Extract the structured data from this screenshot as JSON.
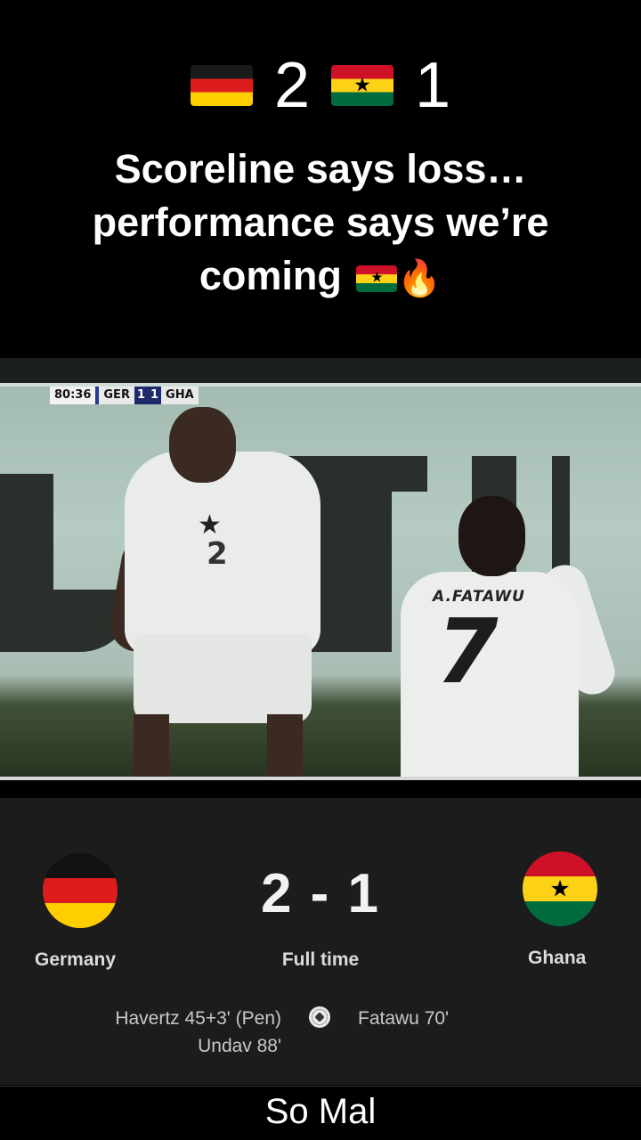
{
  "caption": {
    "home_score": "2",
    "away_score": "1",
    "line1": "Scoreline says loss…",
    "line2": "performance says we’re",
    "line3": "coming",
    "home_flag_icon": "germany-flag-icon",
    "away_flag_icon": "ghana-flag-icon",
    "trailing_icon": "fire-icon"
  },
  "video": {
    "clock": "80:36",
    "home_abbr": "GER",
    "home_goals": "1",
    "away_goals": "1",
    "away_abbr": "GHA",
    "jersey_name": "A.FATAWU",
    "jersey_number": "7",
    "other_jersey_number": "2"
  },
  "result": {
    "home_team": "Germany",
    "away_team": "Ghana",
    "score": "2 - 1",
    "status": "Full time",
    "home_scorers": [
      "Havertz 45+3' (Pen)",
      "Undav 88'"
    ],
    "away_scorers": [
      "Fatawu 70'"
    ],
    "goal_icon": "soccer-ball-icon"
  },
  "footer": {
    "text": "So Mal"
  },
  "colors": {
    "background": "#000000",
    "panel": "#1c1c1c",
    "text": "#ffffff"
  }
}
